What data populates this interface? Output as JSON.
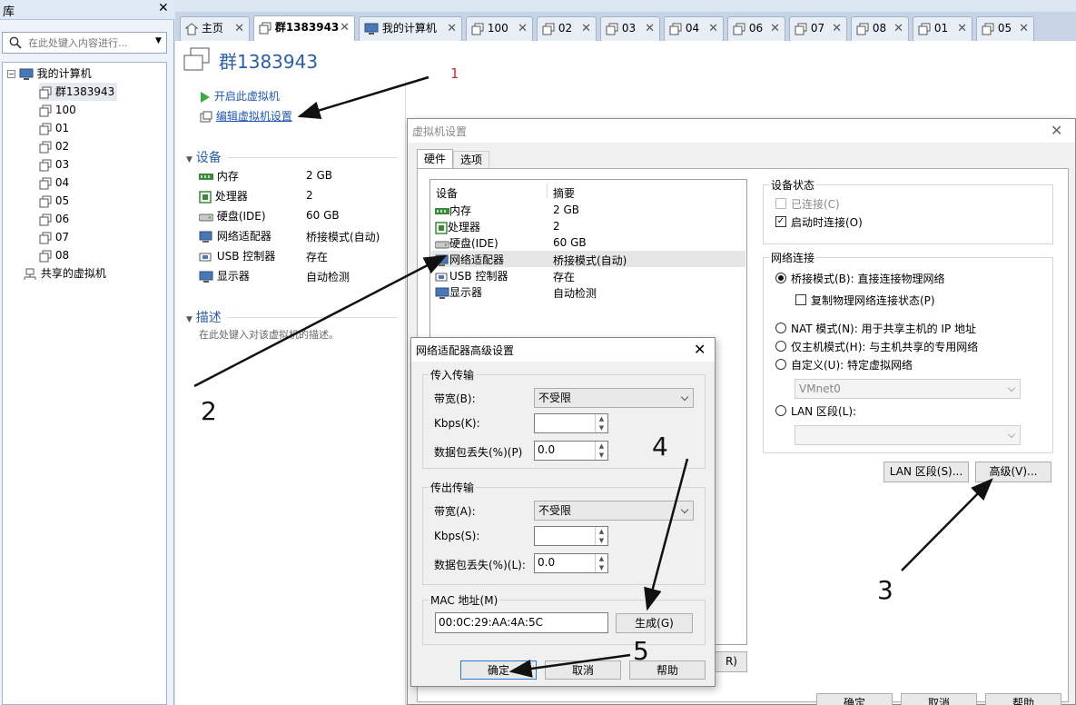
{
  "library": {
    "title": "库",
    "close": "✕",
    "search_placeholder": "在此处键入内容进行...",
    "tree": {
      "root": "我的计算机",
      "items": [
        "群1383943",
        "100",
        "01",
        "02",
        "03",
        "04",
        "05",
        "06",
        "07",
        "08"
      ],
      "shared": "共享的虚拟机"
    }
  },
  "tabs": [
    {
      "label": "主页"
    },
    {
      "label": "群1383943"
    },
    {
      "label": "我的计算机"
    },
    {
      "label": "100"
    },
    {
      "label": "02"
    },
    {
      "label": "03"
    },
    {
      "label": "04"
    },
    {
      "label": "06"
    },
    {
      "label": "07"
    },
    {
      "label": "08"
    },
    {
      "label": "01"
    },
    {
      "label": "05"
    }
  ],
  "vm": {
    "title": "群1383943",
    "actions": {
      "start": "开启此虚拟机",
      "edit": "编辑虚拟机设置"
    },
    "devices_header": "设备",
    "devices": [
      {
        "name": "内存",
        "value": "2 GB"
      },
      {
        "name": "处理器",
        "value": "2"
      },
      {
        "name": "硬盘(IDE)",
        "value": "60 GB"
      },
      {
        "name": "网络适配器",
        "value": "桥接模式(自动)"
      },
      {
        "name": "USB 控制器",
        "value": "存在"
      },
      {
        "name": "显示器",
        "value": "自动检测"
      }
    ],
    "desc_header": "描述",
    "desc_placeholder": "在此处键入对该虚拟机的描述。"
  },
  "settings": {
    "title": "虚拟机设置",
    "tabs": [
      "硬件",
      "选项"
    ],
    "col_device": "设备",
    "col_summary": "摘要",
    "rows": [
      {
        "name": "内存",
        "value": "2 GB"
      },
      {
        "name": "处理器",
        "value": "2"
      },
      {
        "name": "硬盘(IDE)",
        "value": "60 GB"
      },
      {
        "name": "网络适配器",
        "value": "桥接模式(自动)"
      },
      {
        "name": "USB 控制器",
        "value": "存在"
      },
      {
        "name": "显示器",
        "value": "自动检测"
      }
    ],
    "device_status": {
      "title": "设备状态",
      "connected": "已连接(C)",
      "connect_on_power": "启动时连接(O)"
    },
    "net": {
      "title": "网络连接",
      "bridged": "桥接模式(B): 直接连接物理网络",
      "replicate": "复制物理网络连接状态(P)",
      "nat": "NAT 模式(N): 用于共享主机的 IP 地址",
      "host_only": "仅主机模式(H): 与主机共享的专用网络",
      "custom": "自定义(U): 特定虚拟网络",
      "vmnet": "VMnet0",
      "lan": "LAN 区段(L):"
    },
    "lan_btn": "LAN 区段(S)...",
    "adv_btn": "高级(V)...",
    "partial_btn": "R)",
    "ok": "确定",
    "cancel": "取消",
    "help": "帮助"
  },
  "adv": {
    "title": "网络适配器高级设置",
    "incoming": "传入传输",
    "outgoing": "传出传输",
    "bw_in": "带宽(B):",
    "bw_out": "带宽(A):",
    "bw_val": "不受限",
    "kbps_in": "Kbps(K):",
    "kbps_out": "Kbps(S):",
    "loss_in": "数据包丢失(%)(P)",
    "loss_out": "数据包丢失(%)(L):",
    "loss_val": "0.0",
    "mac_title": "MAC 地址(M)",
    "mac": "00:0C:29:AA:4A:5C",
    "generate": "生成(G)",
    "ok": "确定",
    "cancel": "取消",
    "help": "帮助"
  },
  "annotations": [
    "1",
    "2",
    "3",
    "4",
    "5"
  ]
}
